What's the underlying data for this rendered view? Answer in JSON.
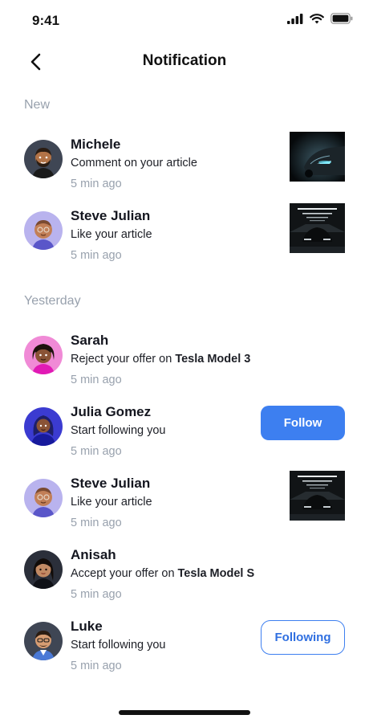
{
  "status": {
    "time": "9:41"
  },
  "header": {
    "title": "Notification",
    "back_icon": "chevron-left-icon"
  },
  "sections": {
    "new": "New",
    "yesterday": "Yesterday"
  },
  "items": [
    {
      "name": "Michele",
      "message": "Comment on your article",
      "time": "5 min ago",
      "avatar_color": "#3f4654",
      "thumb": "car-headlight"
    },
    {
      "name": "Steve Julian",
      "message": "Like your article",
      "time": "5 min ago",
      "avatar_color": "#b9b3ee",
      "thumb": "car-garage"
    },
    {
      "name": "Sarah",
      "message_prefix": "Reject your offer on ",
      "message_bold": "Tesla Model 3",
      "time": "5 min ago",
      "avatar_color": "#f08ad6"
    },
    {
      "name": "Julia Gomez",
      "message": "Start following you",
      "time": "5 min ago",
      "avatar_color": "#3b3bd1",
      "action": "Follow"
    },
    {
      "name": "Steve Julian",
      "message": "Like your article",
      "time": "5 min ago",
      "avatar_color": "#b9b3ee",
      "thumb": "car-garage"
    },
    {
      "name": "Anisah",
      "message_prefix": "Accept your offer on ",
      "message_bold": "Tesla Model S",
      "time": "5 min ago",
      "avatar_color": "#2b2f3a"
    },
    {
      "name": "Luke",
      "message": "Start following you",
      "time": "5 min ago",
      "avatar_color": "#3f4654",
      "action": "Following"
    }
  ],
  "colors": {
    "accent": "#3d7ff0",
    "muted_text": "#98a1ad",
    "primary_text": "#14161f"
  }
}
